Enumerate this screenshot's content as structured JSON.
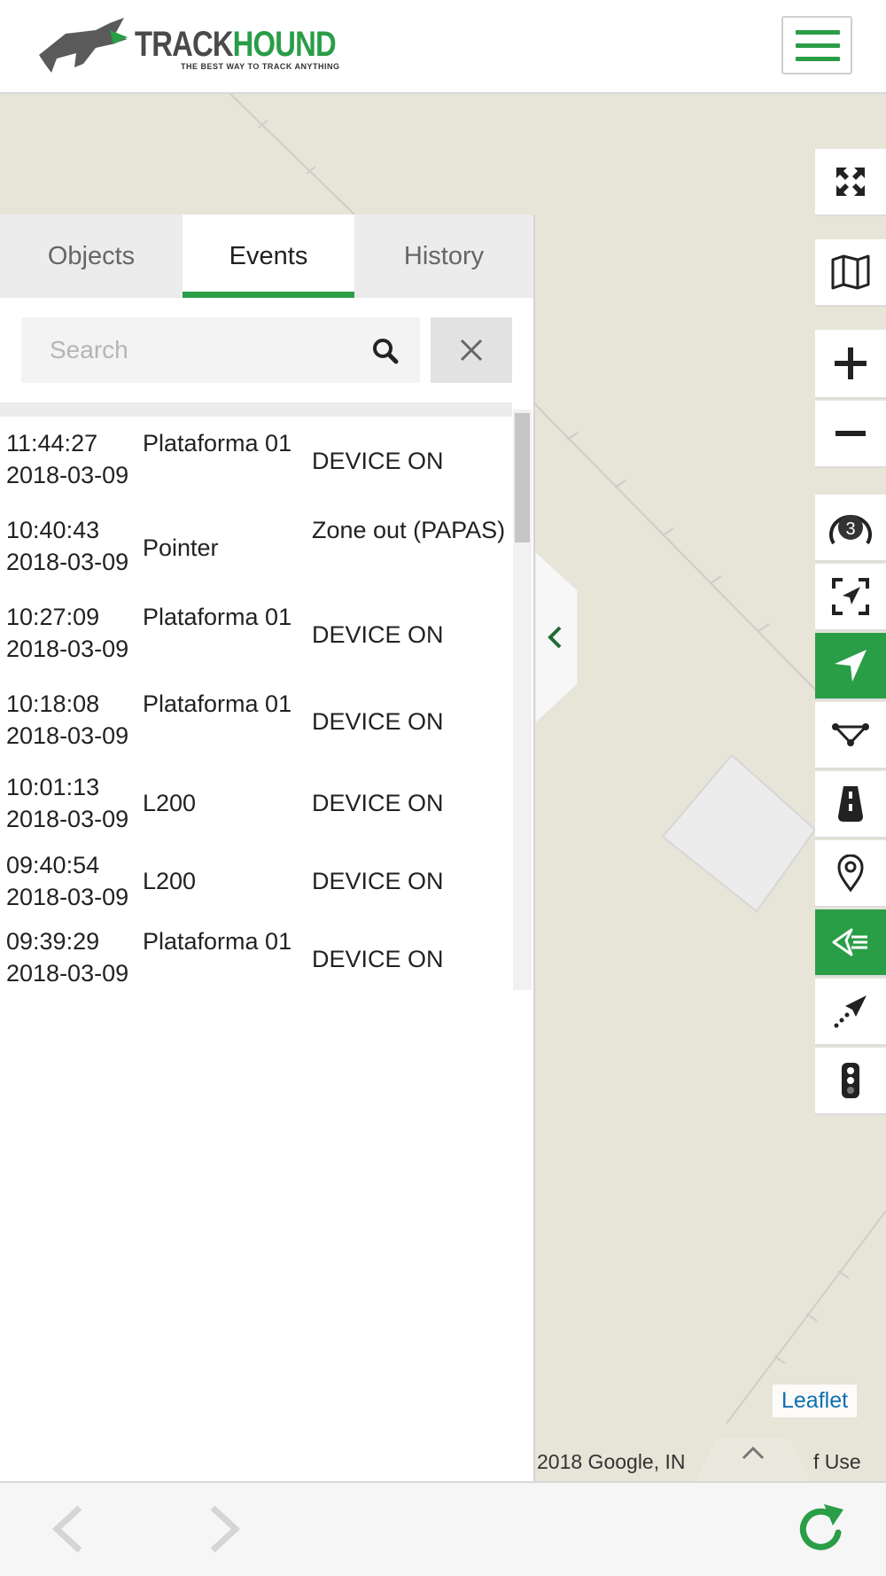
{
  "header": {
    "logo_text_dark": "TRACK",
    "logo_text_green": "HOUND",
    "logo_tagline": "THE BEST WAY TO TRACK ANYTHING",
    "menu_icon": "hamburger-menu-icon"
  },
  "colors": {
    "accent": "#2a9d47",
    "map_background": "#e7e4d8",
    "link": "#0f6fb1"
  },
  "tabs": [
    {
      "label": "Objects",
      "active": false
    },
    {
      "label": "Events",
      "active": true
    },
    {
      "label": "History",
      "active": false
    }
  ],
  "search": {
    "placeholder": "Search",
    "value": "",
    "search_icon": "search-icon",
    "clear_icon": "close-icon"
  },
  "events": [
    {
      "time": "11:44:27",
      "date": "2018-03-09",
      "object": "Plataforma 01",
      "event": "DEVICE ON"
    },
    {
      "time": "10:40:43",
      "date": "2018-03-09",
      "object": "Pointer",
      "event": "Zone out (PAPAS)"
    },
    {
      "time": "10:27:09",
      "date": "2018-03-09",
      "object": "Plataforma 01",
      "event": "DEVICE ON"
    },
    {
      "time": "10:18:08",
      "date": "2018-03-09",
      "object": "Plataforma 01",
      "event": "DEVICE ON"
    },
    {
      "time": "10:01:13",
      "date": "2018-03-09",
      "object": "L200",
      "event": "DEVICE ON"
    },
    {
      "time": "09:40:54",
      "date": "2018-03-09",
      "object": "L200",
      "event": "DEVICE ON"
    },
    {
      "time": "09:39:29",
      "date": "2018-03-09",
      "object": "Plataforma 01",
      "event": "DEVICE ON"
    }
  ],
  "map": {
    "attribution_link": "Leaflet",
    "copyright_left": "2018 Google, IN",
    "copyright_right": "f Use",
    "toolbar": [
      {
        "icon": "fullscreen-icon",
        "active": false
      },
      {
        "icon": "map-layers-icon",
        "active": false
      },
      {
        "icon": "zoom-in-icon",
        "active": false
      },
      {
        "icon": "zoom-out-icon",
        "active": false
      },
      {
        "icon": "cluster-count-icon",
        "badge": "3",
        "active": false
      },
      {
        "icon": "fit-bounds-icon",
        "active": false
      },
      {
        "icon": "follow-location-icon",
        "active": true
      },
      {
        "icon": "route-draw-icon",
        "active": false
      },
      {
        "icon": "road-icon",
        "active": false
      },
      {
        "icon": "map-pin-icon",
        "active": false
      },
      {
        "icon": "event-list-icon",
        "active": true
      },
      {
        "icon": "route-tail-icon",
        "active": false
      },
      {
        "icon": "traffic-light-icon",
        "active": false
      }
    ]
  },
  "bottom_bar": {
    "back_icon": "chevron-left-icon",
    "forward_icon": "chevron-right-icon",
    "refresh_icon": "refresh-icon"
  }
}
